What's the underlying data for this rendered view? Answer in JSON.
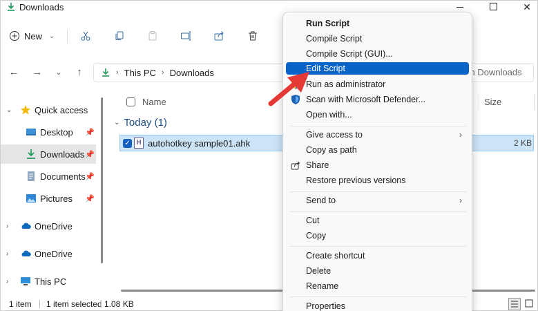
{
  "window": {
    "title": "Downloads"
  },
  "toolbar": {
    "new_label": "New"
  },
  "address": {
    "crumbs": [
      "This PC",
      "Downloads"
    ],
    "search_placeholder": "ch Downloads"
  },
  "nav_pane": {
    "quick_access": "Quick access",
    "items": [
      "Desktop",
      "Downloads",
      "Documents",
      "Pictures"
    ],
    "onedrive_1": "OneDrive",
    "onedrive_2": "OneDrive",
    "this_pc": "This PC"
  },
  "content": {
    "col_name": "Name",
    "col_size": "Size",
    "group_label": "Today (1)",
    "file": {
      "name": "autohotkey sample01.ahk",
      "size": "2 KB",
      "icon_letter": "H"
    }
  },
  "status": {
    "count": "1 item",
    "selected": "1 item selected",
    "size": "1.08 KB"
  },
  "context_menu": {
    "items": [
      "Run Script",
      "Compile Script",
      "Compile Script (GUI)...",
      "Edit Script",
      "Run as administrator",
      "Scan with Microsoft Defender...",
      "Open with...",
      "Give access to",
      "Copy as path",
      "Share",
      "Restore previous versions",
      "Send to",
      "Cut",
      "Copy",
      "Create shortcut",
      "Delete",
      "Rename",
      "Properties"
    ],
    "highlighted": "Edit Script"
  },
  "colors": {
    "accent": "#0a64c8",
    "selection_bg": "#cce4f7",
    "folder_blue": "#1a4f8a",
    "arrow_red": "#e53935"
  }
}
